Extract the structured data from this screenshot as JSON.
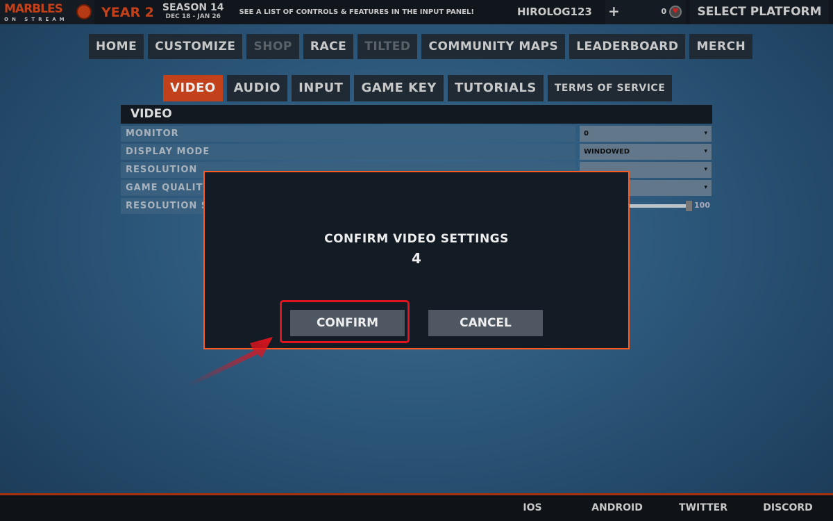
{
  "header": {
    "logo_text": "MARBLES",
    "logo_sub": "ON STREAM",
    "year": "YEAR 2",
    "season": "SEASON 14",
    "dates": "DEC 18 - JAN 26",
    "tip": "SEE A LIST OF CONTROLS & FEATURES IN THE INPUT PANEL!",
    "username": "HIROLOG123",
    "plus": "+",
    "coins": "0",
    "platform": "SELECT PLATFORM"
  },
  "nav": [
    "HOME",
    "CUSTOMIZE",
    "SHOP",
    "RACE",
    "TILTED",
    "COMMUNITY MAPS",
    "LEADERBOARD",
    "MERCH"
  ],
  "tabs": [
    "VIDEO",
    "AUDIO",
    "INPUT",
    "GAME KEY",
    "TUTORIALS",
    "TERMS OF SERVICE"
  ],
  "panel": {
    "title": "VIDEO",
    "rows": [
      {
        "label": "MONITOR",
        "value": "0"
      },
      {
        "label": "DISPLAY MODE",
        "value": "WINDOWED"
      },
      {
        "label": "RESOLUTION",
        "value": ""
      },
      {
        "label": "GAME QUALITY",
        "value": ""
      },
      {
        "label": "RESOLUTION SCALE",
        "value": "100"
      }
    ]
  },
  "modal": {
    "title": "CONFIRM VIDEO SETTINGS",
    "countdown": "4",
    "confirm": "CONFIRM",
    "cancel": "CANCEL"
  },
  "footer": [
    "IOS",
    "ANDROID",
    "TWITTER",
    "DISCORD"
  ],
  "colors": {
    "accent": "#c2401a",
    "modal_border": "#ff5a1f",
    "highlight": "#e0141e"
  }
}
